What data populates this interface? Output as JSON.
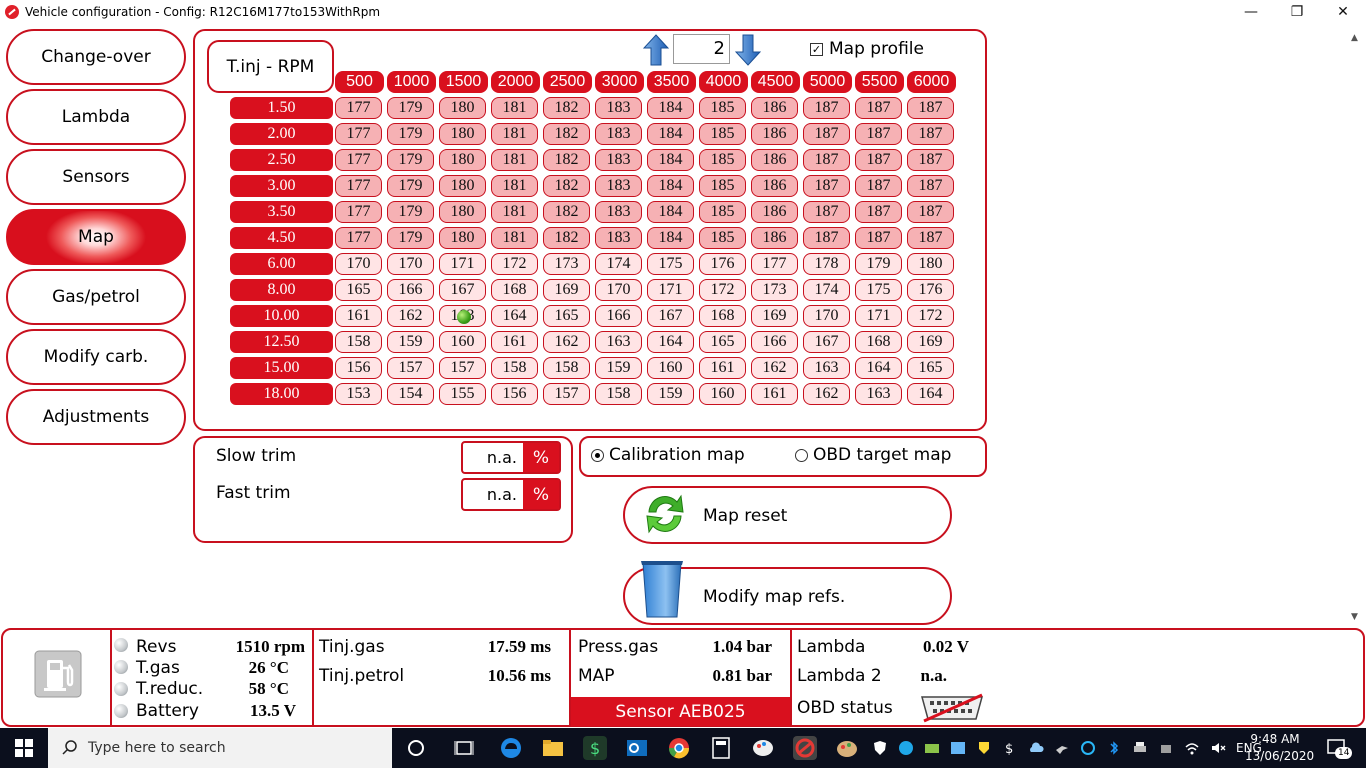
{
  "window": {
    "title": "Vehicle configuration - Config: R12C16M177to153WithRpm",
    "controls": {
      "minimize": "—",
      "maximize": "❐",
      "close": "✕"
    }
  },
  "nav": {
    "items": [
      {
        "label": "Change-over",
        "active": false
      },
      {
        "label": "Lambda",
        "active": false
      },
      {
        "label": "Sensors",
        "active": false
      },
      {
        "label": "Map",
        "active": true
      },
      {
        "label": "Gas/petrol",
        "active": false
      },
      {
        "label": "Modify carb.",
        "active": false
      },
      {
        "label": "Adjustments",
        "active": false
      }
    ]
  },
  "map": {
    "title": "T.inj - RPM",
    "profile_number": "2",
    "map_profile_label": "Map profile",
    "map_profile_checked": true,
    "rpm": [
      "500",
      "1000",
      "1500",
      "2000",
      "2500",
      "3000",
      "3500",
      "4000",
      "4500",
      "5000",
      "5500",
      "6000"
    ],
    "rows": [
      {
        "tinj": "1.50",
        "values": [
          "177",
          "179",
          "180",
          "181",
          "182",
          "183",
          "184",
          "185",
          "186",
          "187",
          "187",
          "187"
        ]
      },
      {
        "tinj": "2.00",
        "values": [
          "177",
          "179",
          "180",
          "181",
          "182",
          "183",
          "184",
          "185",
          "186",
          "187",
          "187",
          "187"
        ]
      },
      {
        "tinj": "2.50",
        "values": [
          "177",
          "179",
          "180",
          "181",
          "182",
          "183",
          "184",
          "185",
          "186",
          "187",
          "187",
          "187"
        ]
      },
      {
        "tinj": "3.00",
        "values": [
          "177",
          "179",
          "180",
          "181",
          "182",
          "183",
          "184",
          "185",
          "186",
          "187",
          "187",
          "187"
        ]
      },
      {
        "tinj": "3.50",
        "values": [
          "177",
          "179",
          "180",
          "181",
          "182",
          "183",
          "184",
          "185",
          "186",
          "187",
          "187",
          "187"
        ]
      },
      {
        "tinj": "4.50",
        "values": [
          "177",
          "179",
          "180",
          "181",
          "182",
          "183",
          "184",
          "185",
          "186",
          "187",
          "187",
          "187"
        ]
      },
      {
        "tinj": "6.00",
        "values": [
          "170",
          "170",
          "171",
          "172",
          "173",
          "174",
          "175",
          "176",
          "177",
          "178",
          "179",
          "180"
        ]
      },
      {
        "tinj": "8.00",
        "values": [
          "165",
          "166",
          "167",
          "168",
          "169",
          "170",
          "171",
          "172",
          "173",
          "174",
          "175",
          "176"
        ]
      },
      {
        "tinj": "10.00",
        "values": [
          "161",
          "162",
          "163",
          "164",
          "165",
          "166",
          "167",
          "168",
          "169",
          "170",
          "171",
          "172"
        ]
      },
      {
        "tinj": "12.50",
        "values": [
          "158",
          "159",
          "160",
          "161",
          "162",
          "163",
          "164",
          "165",
          "166",
          "167",
          "168",
          "169"
        ]
      },
      {
        "tinj": "15.00",
        "values": [
          "156",
          "157",
          "157",
          "158",
          "158",
          "159",
          "160",
          "161",
          "162",
          "163",
          "164",
          "165"
        ]
      },
      {
        "tinj": "18.00",
        "values": [
          "153",
          "154",
          "155",
          "156",
          "157",
          "158",
          "159",
          "160",
          "161",
          "162",
          "163",
          "164"
        ]
      }
    ],
    "cursor_cell": {
      "row": 8,
      "col": 2
    }
  },
  "trim": {
    "slow_label": "Slow trim",
    "slow_value": "n.a.",
    "fast_label": "Fast trim",
    "fast_value": "n.a.",
    "unit": "%"
  },
  "map_type": {
    "calibration_label": "Calibration map",
    "obd_label": "OBD target map",
    "selected": "calibration"
  },
  "actions": {
    "map_reset_label": "Map reset",
    "modify_refs_label": "Modify map refs."
  },
  "status": {
    "revs_label": "Revs",
    "revs_value": "1510 rpm",
    "tgas_label": "T.gas",
    "tgas_value": "26 °C",
    "treduc_label": "T.reduc.",
    "treduc_value": "58 °C",
    "battery_label": "Battery",
    "battery_value": "13.5 V",
    "tinj_gas_label": "Tinj.gas",
    "tinj_gas_value": "17.59 ms",
    "tinj_petrol_label": "Tinj.petrol",
    "tinj_petrol_value": "10.56 ms",
    "press_gas_label": "Press.gas",
    "press_gas_value": "1.04 bar",
    "map_label": "MAP",
    "map_value": "0.81 bar",
    "sensor_label": "Sensor AEB025",
    "lambda_label": "Lambda",
    "lambda_value": "0.02 V",
    "lambda2_label": "Lambda 2",
    "lambda2_value": "n.a.",
    "obd_status_label": "OBD status"
  },
  "taskbar": {
    "search_placeholder": "Type here to search",
    "language": "ENG",
    "time": "9:48 AM",
    "date": "13/06/2020",
    "notification_count": "14"
  },
  "colors": {
    "accent_red": "#d9101e",
    "cell_pink": "#f6b1b4",
    "cell_light": "#ffe4e5"
  }
}
